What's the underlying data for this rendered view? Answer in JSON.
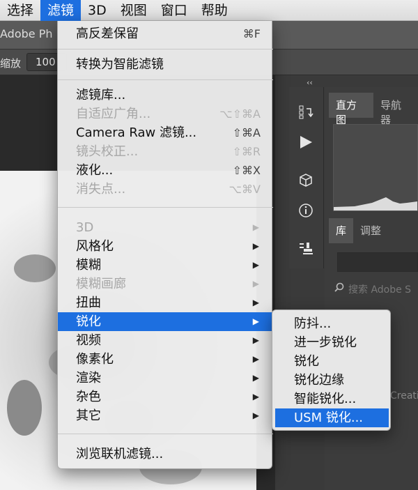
{
  "menubar": {
    "items": [
      "选择",
      "滤镜",
      "3D",
      "视图",
      "窗口",
      "帮助"
    ],
    "active_index": 1,
    "accent_color": "#1d6fe0"
  },
  "app": {
    "title": "Adobe Ph",
    "zoom_label": "缩放",
    "zoom_value": "100"
  },
  "panels": {
    "collapse": "‹‹",
    "tabs_top": [
      "直方图",
      "导航器"
    ],
    "tabs_bottom": [
      "库",
      "调整"
    ],
    "search_placeholder": "搜索 Adobe S",
    "creative_text": "Creativ",
    "tool_icons": [
      "history-icon",
      "play-icon",
      "3d-cube-icon",
      "info-icon",
      "clone-stamp-icon"
    ]
  },
  "filter_menu": {
    "last_filter": "高反差保留",
    "last_filter_shortcut": "⌘F",
    "convert_smart": "转换为智能滤镜",
    "group1": [
      {
        "label": "滤镜库...",
        "shortcut": "",
        "disabled": false
      },
      {
        "label": "自适应广角...",
        "shortcut": "⌥⇧⌘A",
        "disabled": true
      },
      {
        "label": "Camera Raw 滤镜...",
        "shortcut": "⇧⌘A",
        "disabled": false
      },
      {
        "label": "镜头校正...",
        "shortcut": "⇧⌘R",
        "disabled": true
      },
      {
        "label": "液化...",
        "shortcut": "⇧⌘X",
        "disabled": false
      },
      {
        "label": "消失点...",
        "shortcut": "⌥⌘V",
        "disabled": true
      }
    ],
    "group2": [
      {
        "label": "3D",
        "disabled": true
      },
      {
        "label": "风格化",
        "disabled": false
      },
      {
        "label": "模糊",
        "disabled": false
      },
      {
        "label": "模糊画廊",
        "disabled": true
      },
      {
        "label": "扭曲",
        "disabled": false
      },
      {
        "label": "锐化",
        "disabled": false,
        "highlighted": true
      },
      {
        "label": "视频",
        "disabled": false
      },
      {
        "label": "像素化",
        "disabled": false
      },
      {
        "label": "渲染",
        "disabled": false
      },
      {
        "label": "杂色",
        "disabled": false
      },
      {
        "label": "其它",
        "disabled": false
      }
    ],
    "browse_online": "浏览联机滤镜..."
  },
  "sharpen_submenu": {
    "items": [
      "防抖...",
      "进一步锐化",
      "锐化",
      "锐化边缘",
      "智能锐化...",
      "USM 锐化..."
    ],
    "highlighted_index": 5
  }
}
